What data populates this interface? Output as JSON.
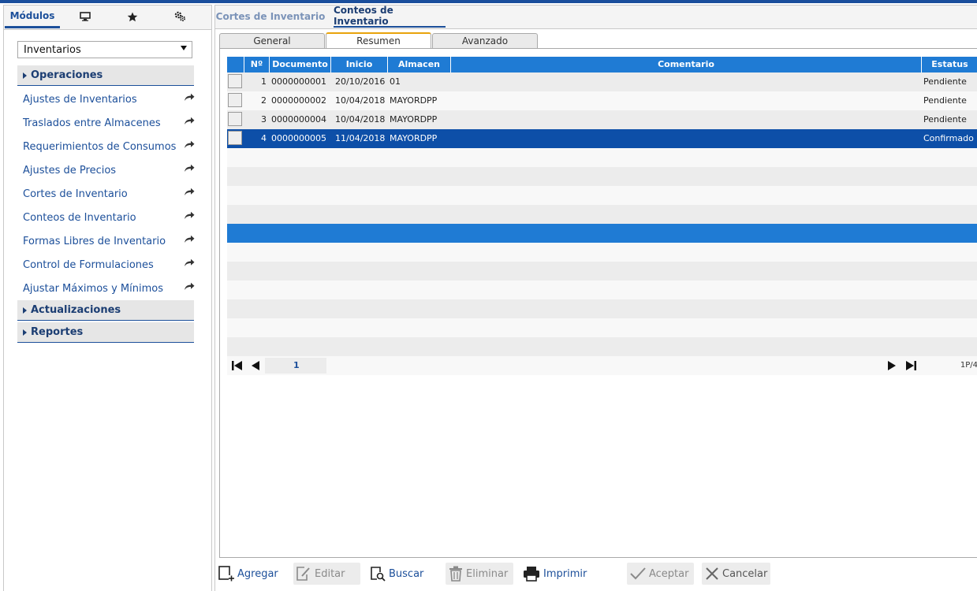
{
  "left_tabs": {
    "modules_label": "Módulos",
    "icons": [
      "monitor-icon",
      "star-icon",
      "settings-gear-icon"
    ]
  },
  "module_select": {
    "value": "Inventarios"
  },
  "sections": {
    "operaciones": "Operaciones",
    "actualizaciones": "Actualizaciones",
    "reportes": "Reportes"
  },
  "menu": [
    "Ajustes de Inventarios",
    "Traslados entre Almacenes",
    "Requerimientos de Consumos",
    "Ajustes de Precios",
    "Cortes de Inventario",
    "Conteos de Inventario",
    "Formas Libres de Inventario",
    "Control de Formulaciones",
    "Ajustar Máximos y Mínimos"
  ],
  "right_tabs": [
    "Cortes de Inventario",
    "Conteos de Inventario"
  ],
  "active_right_tab": "Conteos de Inventario",
  "subtabs": [
    "General",
    "Resumen",
    "Avanzado"
  ],
  "active_subtab": "Resumen",
  "grid": {
    "headers": {
      "num": "Nº",
      "documento": "Documento",
      "inicio": "Inicio",
      "almacen": "Almacen",
      "comentario": "Comentario",
      "estatus": "Estatus"
    },
    "rows": [
      {
        "num": "1",
        "documento": "0000000001",
        "inicio": "20/10/2016",
        "almacen": "01",
        "comentario": "",
        "estatus": "Pendiente"
      },
      {
        "num": "2",
        "documento": "0000000002",
        "inicio": "10/04/2018",
        "almacen": "MAYORDPP",
        "comentario": "",
        "estatus": "Pendiente"
      },
      {
        "num": "3",
        "documento": "0000000004",
        "inicio": "10/04/2018",
        "almacen": "MAYORDPP",
        "comentario": "",
        "estatus": "Pendiente"
      },
      {
        "num": "4",
        "documento": "0000000005",
        "inicio": "11/04/2018",
        "almacen": "MAYORDPP",
        "comentario": "",
        "estatus": "Confirmado"
      }
    ],
    "selected_row": 4
  },
  "pager": {
    "page": "1",
    "info": "1P/4"
  },
  "toolbar": {
    "agregar": "Agregar",
    "editar": "Editar",
    "buscar": "Buscar",
    "eliminar": "Eliminar",
    "imprimir": "Imprimir",
    "aceptar": "Aceptar",
    "cancelar": "Cancelar"
  },
  "colors": {
    "primary": "#1c4f9a",
    "header_blue": "#1f7bd4",
    "selected_row": "#0d4fa8",
    "active_subtab_accent": "#e8a30c"
  }
}
